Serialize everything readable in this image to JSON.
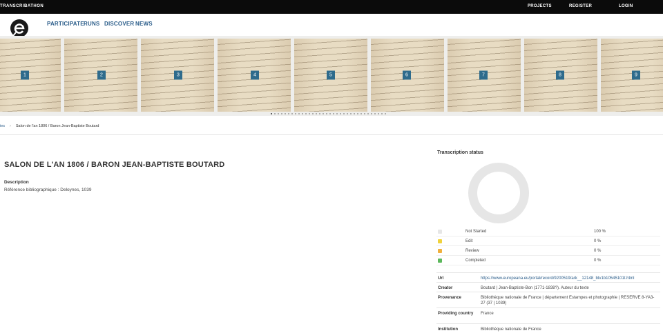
{
  "topbar": {
    "brand": "TRANSCRIBATHON",
    "nav": [
      "PROJECTS",
      "REGISTER",
      "LOGIN"
    ]
  },
  "logo": {
    "line1": "europeana",
    "line2": "transcribe"
  },
  "nav": [
    "PARTICIPATE",
    "RUNS",
    "DISCOVER",
    "NEWS"
  ],
  "carousel": {
    "slides": [
      "1",
      "2",
      "3",
      "4",
      "5",
      "6",
      "7",
      "8",
      "9"
    ],
    "dot_count": 34,
    "active_dot": 0
  },
  "breadcrumb": {
    "prev": "ies",
    "current": "Salon de l'an 1806 / Baron Jean-Baptiste Boutard"
  },
  "story": {
    "title": "SALON DE L'AN 1806 / BARON JEAN-BAPTISTE BOUTARD",
    "description_label": "Description",
    "description": "Référence bibliographique : Deloynes, 1039"
  },
  "status": {
    "title": "Transcription status",
    "items": [
      {
        "label": "Not Started",
        "percent": "100 %",
        "value": 100,
        "color": "#e6e6e6"
      },
      {
        "label": "Edit",
        "percent": "0 %",
        "value": 0,
        "color": "#f0d23c"
      },
      {
        "label": "Review",
        "percent": "0 %",
        "value": 0,
        "color": "#f0b03c"
      },
      {
        "label": "Completed",
        "percent": "0 %",
        "value": 0,
        "color": "#5cb85c"
      }
    ]
  },
  "metadata": [
    {
      "key": "Url",
      "value": "https://www.europeana.eu/portal/record/9200519/ark__12148_btv1b10545101t.html"
    },
    {
      "key": "Creator",
      "value": "Boutard | Jean-Baptiste-Bon (1771-1838?). Auteur du texte"
    },
    {
      "key": "Provenance",
      "value": "Bibliothèque nationale de France | département Estampes et photographie | RESERVE 8-YA3-27 (37 | 1039)"
    },
    {
      "key": "Providing country",
      "value": "France"
    },
    {
      "key": "Institution",
      "value": "Bibliothèque nationale de France"
    }
  ]
}
